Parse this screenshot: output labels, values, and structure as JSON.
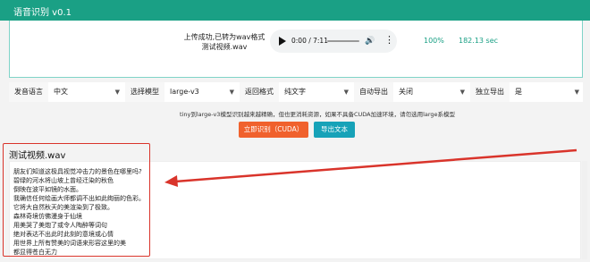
{
  "app": {
    "title": "语音识别 v0.1"
  },
  "upload": {
    "message": "上传成功,已转为wav格式 测试视频.wav",
    "audio_time": "0:00 / 7:11",
    "progress": "100%",
    "elapsed": "182.13 sec"
  },
  "settings": {
    "language_label": "发音语言",
    "language_value": "中文",
    "model_label": "选择模型",
    "model_value": "large-v3",
    "format_label": "返回格式",
    "format_value": "纯文字",
    "auto_export_label": "自动导出",
    "auto_export_value": "关闭",
    "standalone_export_label": "独立导出",
    "standalone_export_value": "是"
  },
  "hint": "tiny到large-v3模型识别越来越精确，但也更消耗资源，如果不具备CUDA加速环境，请勿选用large系模型",
  "buttons": {
    "start": "立即识别（CUDA）",
    "export": "导出文本"
  },
  "result": {
    "title": "测试视频.wav",
    "lines": [
      "朋友们知道这极具视觉冲击力的景色在哪里吗?",
      "碧绿的河水将山坡上曾经迁染的秋色",
      "倒映在波平如镜的水面。",
      "我确信任何绘画大师都调不出如此绚丽的色彩。",
      "它将大自然秋天的美渲染到了极致。",
      "森林奇境仿佛漫身于仙境",
      "用美哭了美炮了或令人陶醉等词句",
      "绝对表达不出此时此刻的意境或心情",
      "用世界上所有赞美的词语来形容这里的美",
      "都显得苍白无力"
    ]
  },
  "colors": {
    "header": "#1aa085",
    "start_button": "#f0612d",
    "export_button": "#17a2b8",
    "annotation": "#d9342b"
  }
}
